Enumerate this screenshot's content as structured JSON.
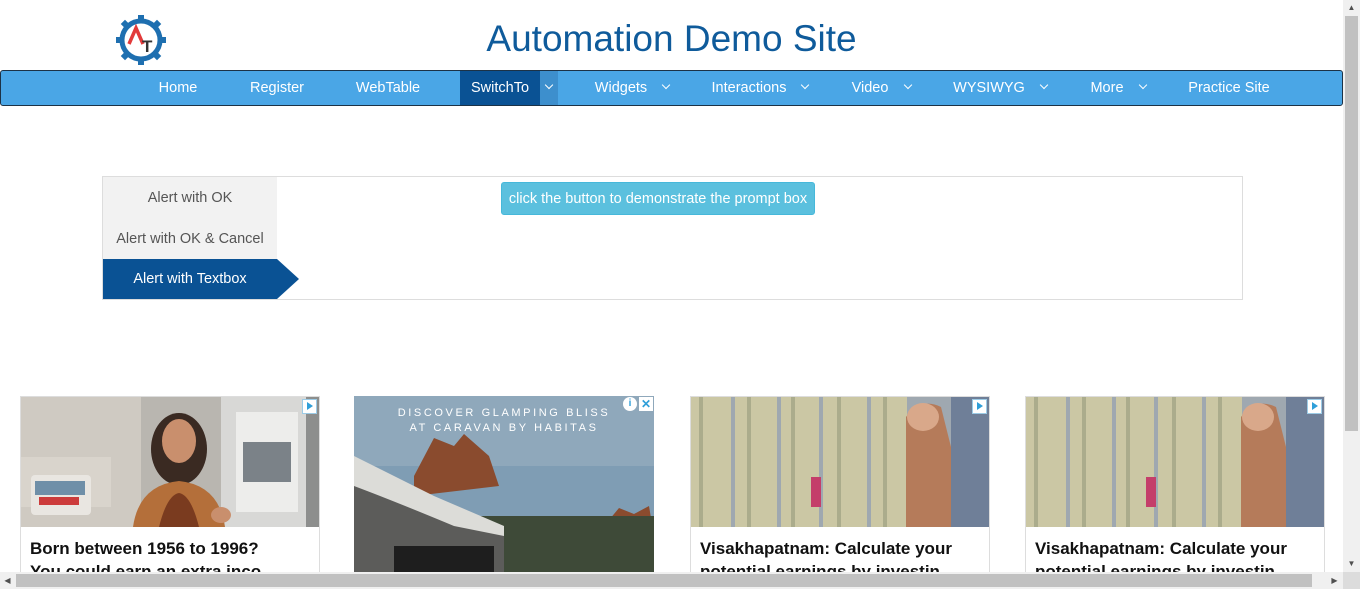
{
  "header": {
    "logo_alt": "AT",
    "title": "Automation Demo Site"
  },
  "nav": {
    "items": [
      {
        "label": "Home"
      },
      {
        "label": "Register"
      },
      {
        "label": "WebTable"
      },
      {
        "label": "SwitchTo",
        "active": true,
        "dropdown": true
      },
      {
        "label": "Widgets",
        "dropdown": true
      },
      {
        "label": "Interactions",
        "dropdown": true
      },
      {
        "label": "Video",
        "dropdown": true
      },
      {
        "label": "WYSIWYG",
        "dropdown": true
      },
      {
        "label": "More",
        "dropdown": true
      },
      {
        "label": "Practice Site"
      }
    ]
  },
  "alerts": {
    "tabs": [
      {
        "label": "Alert with OK"
      },
      {
        "label": "Alert with OK & Cancel"
      },
      {
        "label": "Alert with Textbox",
        "active": true
      }
    ],
    "button_label": "click the button to demonstrate the prompt box"
  },
  "ads": [
    {
      "title_line1": "Born between 1956 to 1996?",
      "title_line2": "You could earn an extra inco..."
    },
    {
      "overlay_line1": "DISCOVER GLAMPING BLISS",
      "overlay_line2": "AT CARAVAN BY HABITAS"
    },
    {
      "title_line1": "Visakhapatnam: Calculate your",
      "title_line2": "potential earnings by investin..."
    },
    {
      "title_line1": "Visakhapatnam: Calculate your",
      "title_line2": "potential earnings by investin..."
    }
  ],
  "colors": {
    "brand_blue": "#0f5b9b",
    "nav_bg": "#4aa6e6",
    "nav_active": "#0a5294",
    "button": "#5bc0de"
  },
  "icons": {
    "logo": "gear-logo-icon",
    "ad_choices": "adchoices-icon",
    "ad_info": "info-icon",
    "ad_close": "close-icon"
  }
}
